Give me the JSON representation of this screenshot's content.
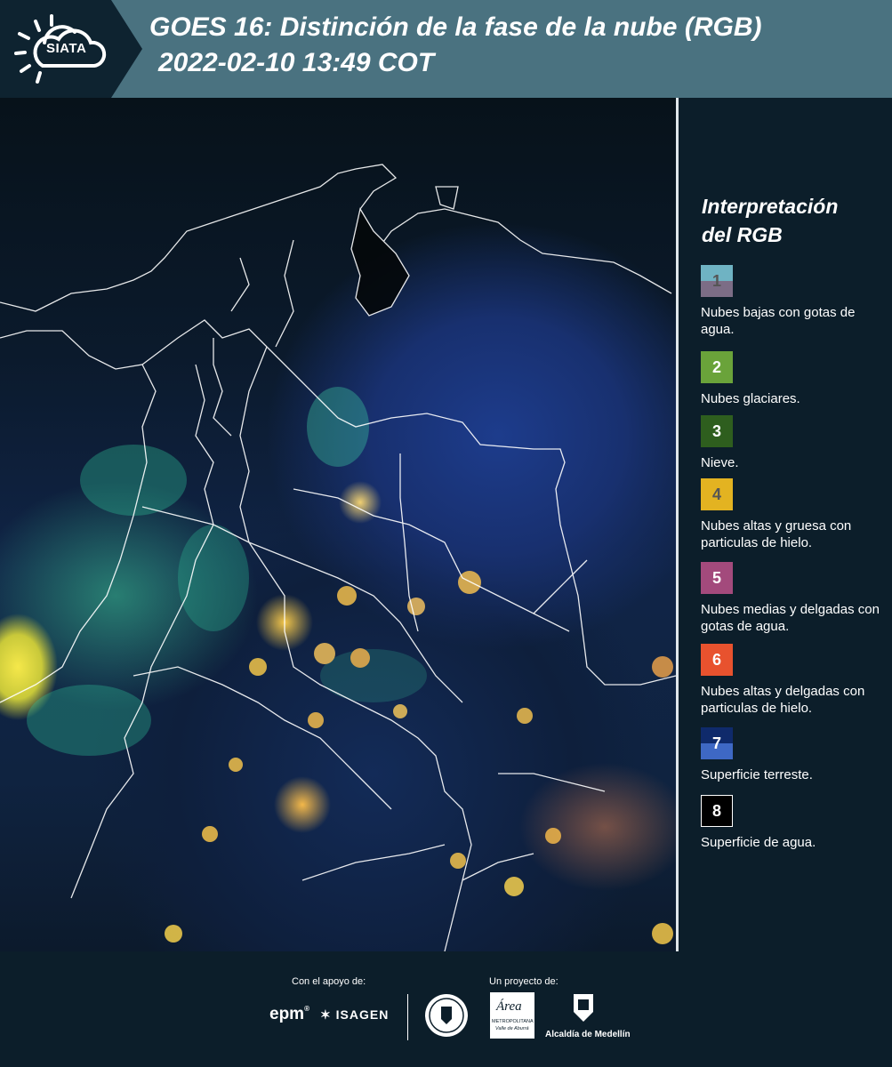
{
  "header": {
    "logo_text": "SIATA",
    "title": "GOES 16: Distinción de la fase de la nube (RGB)",
    "timestamp": "2022-02-10 13:49 COT"
  },
  "legend": {
    "title_line1": "Interpretación",
    "title_line2": "del RGB",
    "items": [
      {
        "number": "1",
        "label": "Nubes bajas con gotas de agua.",
        "color_top": "#6fb3c3",
        "color_bottom": "#7c6d86",
        "text_color": "#555555"
      },
      {
        "number": "2",
        "label": "Nubes glaciares.",
        "color_top": "#6aa33a",
        "color_bottom": "#6aa33a",
        "text_color": "#ffffff"
      },
      {
        "number": "3",
        "label": "Nieve.",
        "color_top": "#2e5e1e",
        "color_bottom": "#2e5e1e",
        "text_color": "#ffffff"
      },
      {
        "number": "4",
        "label": "Nubes altas y gruesa con particulas de hielo.",
        "color_top": "#e3b321",
        "color_bottom": "#e3b321",
        "text_color": "#555555"
      },
      {
        "number": "5",
        "label": "Nubes medias y delgadas con gotas de agua.",
        "color_top": "#a34a7c",
        "color_bottom": "#a34a7c",
        "text_color": "#ffffff"
      },
      {
        "number": "6",
        "label": "Nubes altas y delgadas con particulas de hielo.",
        "color_top": "#e8522e",
        "color_bottom": "#e8522e",
        "text_color": "#ffffff"
      },
      {
        "number": "7",
        "label": "Superficie terreste.",
        "color_top": "#0f2a6b",
        "color_bottom": "#3e68c4",
        "text_color": "#ffffff"
      },
      {
        "number": "8",
        "label": "Superficie de agua.",
        "color_top": "#000000",
        "color_bottom": "#000000",
        "text_color": "#ffffff"
      }
    ]
  },
  "footer": {
    "support_caption": "Con el apoyo de:",
    "project_caption": "Un proyecto de:",
    "brand_epm": "epm",
    "brand_isagen": "ISAGEN",
    "brand_area_line1": "Área",
    "brand_area_line2": "METROPOLITANA",
    "brand_area_line3": "Valle de Aburrá",
    "brand_alcaldia": "Alcaldía de Medellín"
  }
}
